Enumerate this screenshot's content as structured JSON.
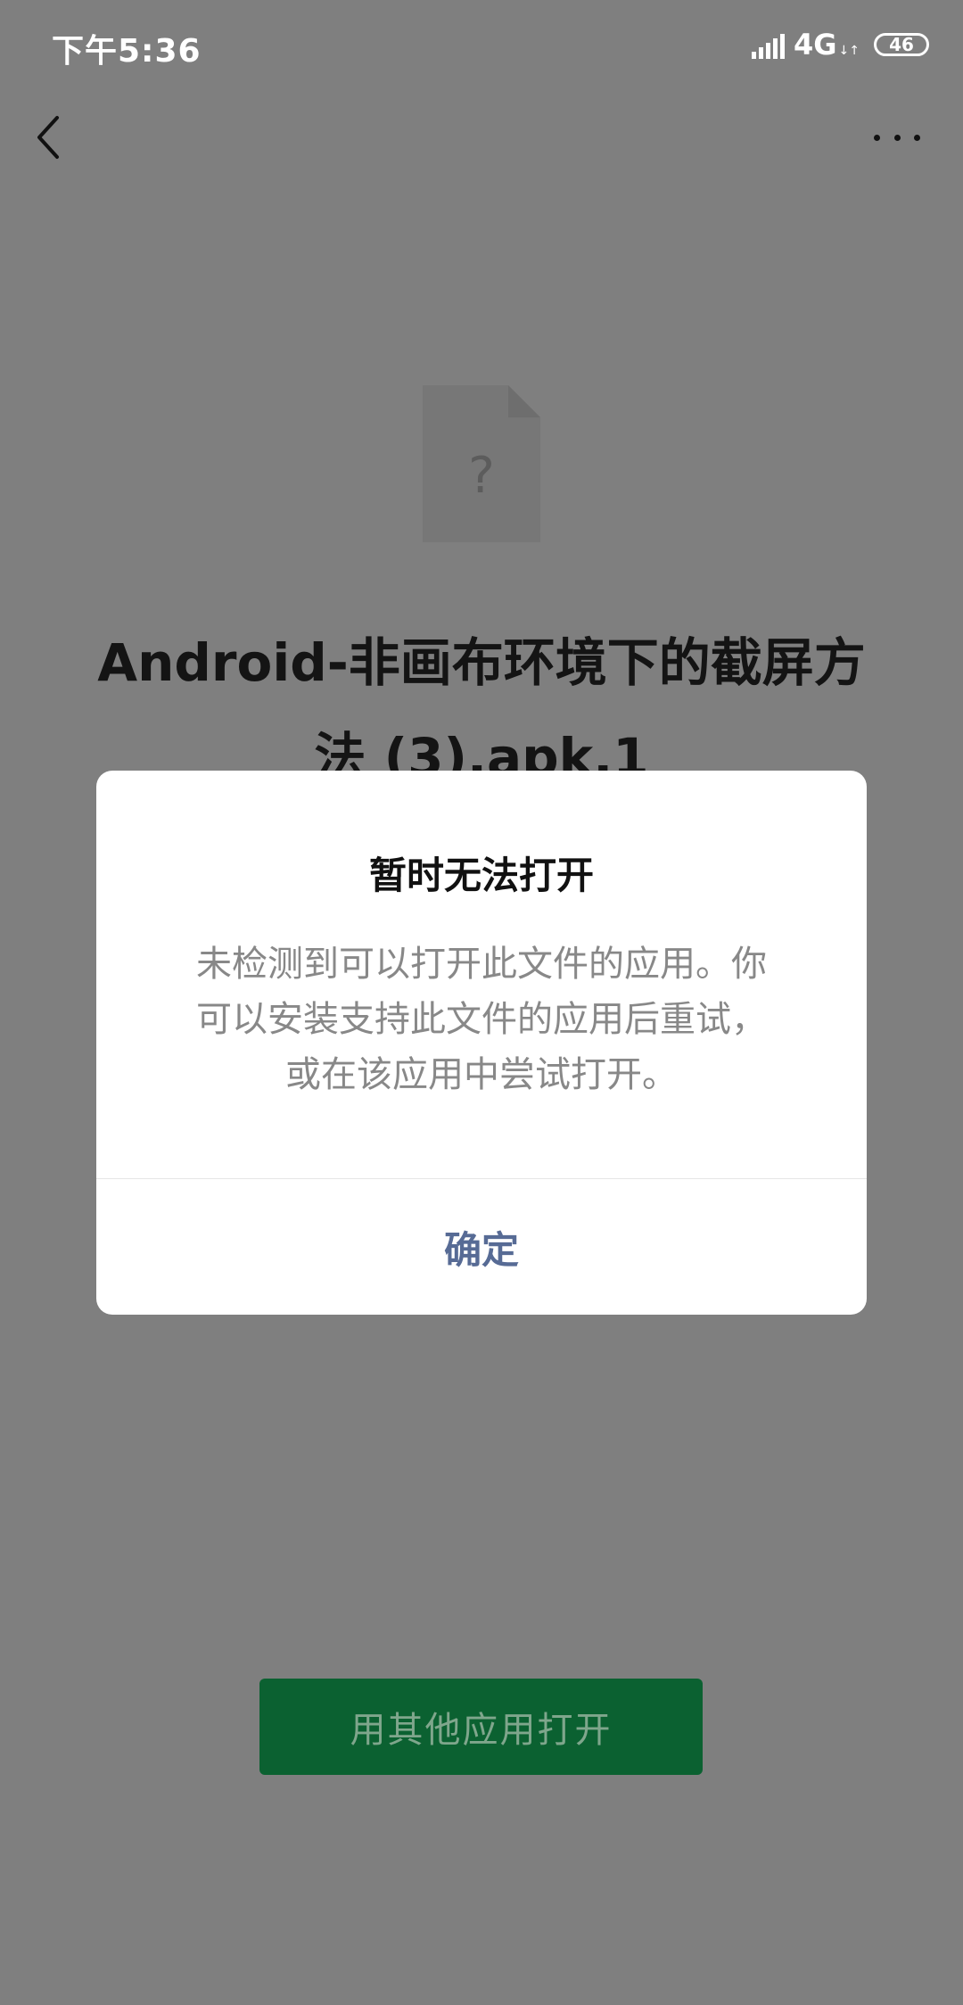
{
  "status_bar": {
    "time": "下午5:36",
    "network": "4G",
    "network_arrows": "↓↑",
    "battery": "46",
    "icons": [
      "signal-icon",
      "battery-icon"
    ]
  },
  "nav": {
    "back_icon": "chevron-left-icon",
    "more_icon": "more-horizontal-icon"
  },
  "file": {
    "icon": "unknown-file-icon",
    "icon_glyph": "?",
    "name_line1": "Android-非画布环境下的截屏方",
    "name_line2": "法 (3).apk.1"
  },
  "primary_action": {
    "label": "用其他应用打开",
    "color": "#0b6131"
  },
  "dialog": {
    "title": "暂时无法打开",
    "message_line1": "未检测到可以打开此文件的应用。你",
    "message_line2": "可以安装支持此文件的应用后重试，",
    "message_line3": "或在该应用中尝试打开。",
    "confirm_label": "确定",
    "confirm_color": "#576b95"
  },
  "colors": {
    "overlay_background": "#7f7f7f",
    "dialog_background": "#ffffff"
  }
}
